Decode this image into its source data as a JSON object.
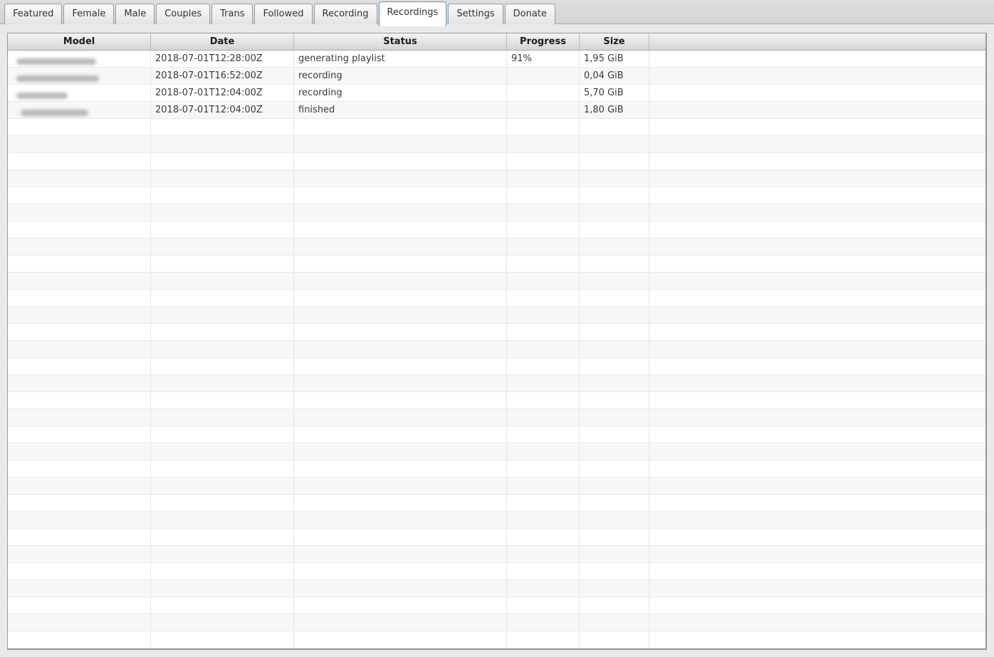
{
  "tabs": {
    "items": [
      {
        "label": "Featured",
        "active": false
      },
      {
        "label": "Female",
        "active": false
      },
      {
        "label": "Male",
        "active": false
      },
      {
        "label": "Couples",
        "active": false
      },
      {
        "label": "Trans",
        "active": false
      },
      {
        "label": "Followed",
        "active": false
      },
      {
        "label": "Recording",
        "active": false
      },
      {
        "label": "Recordings",
        "active": true
      },
      {
        "label": "Settings",
        "active": false
      },
      {
        "label": "Donate",
        "active": false
      }
    ]
  },
  "table": {
    "columns": [
      {
        "label": "Model"
      },
      {
        "label": "Date"
      },
      {
        "label": "Status"
      },
      {
        "label": "Progress"
      },
      {
        "label": "Size"
      },
      {
        "label": ""
      }
    ],
    "rows": [
      {
        "model": "",
        "model_redacted": true,
        "date": "2018-07-01T12:28:00Z",
        "status": "generating playlist",
        "progress": "91%",
        "size": "1,95 GiB"
      },
      {
        "model": "",
        "model_redacted": true,
        "date": "2018-07-01T16:52:00Z",
        "status": "recording",
        "progress": "",
        "size": "0,04 GiB"
      },
      {
        "model": "",
        "model_redacted": true,
        "date": "2018-07-01T12:04:00Z",
        "status": "recording",
        "progress": "",
        "size": "5,70 GiB"
      },
      {
        "model": "",
        "model_redacted": true,
        "date": "2018-07-01T12:04:00Z",
        "status": "finished",
        "progress": "",
        "size": "1,80 GiB"
      }
    ],
    "empty_row_count": 31
  },
  "colors": {
    "active_tab_border": "#4aa2d9",
    "background": "#e9e9e9",
    "row_alt": "#f7f7f7",
    "header_gradient_top": "#f4f4f4",
    "header_gradient_bottom": "#d5d5d5"
  }
}
